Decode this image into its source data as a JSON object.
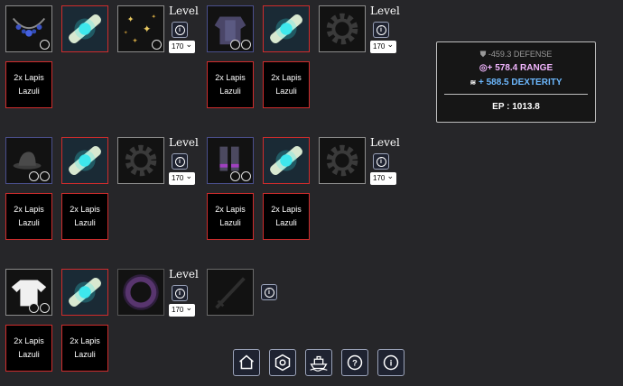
{
  "level_label": "Level",
  "level_value": "170",
  "gem_line1": "2x Lapis",
  "gem_line2": "Lazuli",
  "stats": {
    "defense": "-459.3 DEFENSE",
    "range": "+ 578.4 RANGE",
    "dexterity": "+ 588.5 DEXTERITY",
    "ep": "EP : 1013.8"
  },
  "colors": {
    "accent_border": "#d02c2c",
    "range": "#f2b6ff",
    "dexterity": "#6db9ff",
    "panel": "#161616"
  },
  "icons": [
    "necklace-icon",
    "scroll-icon",
    "sparkles-icon",
    "armor-icon",
    "gear-icon",
    "hat-icon",
    "boots-icon",
    "shirt-icon",
    "void-ring-icon",
    "sword-icon",
    "home-icon",
    "hexagon-icon",
    "ship-icon",
    "question-icon",
    "info-icon"
  ]
}
